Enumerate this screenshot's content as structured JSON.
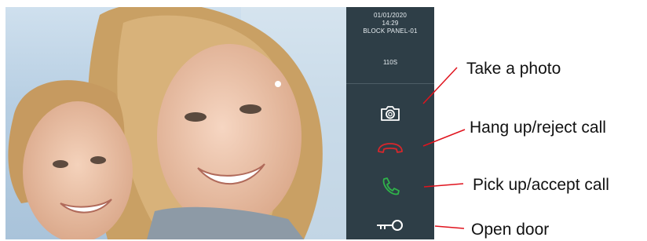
{
  "panel": {
    "date": "01/01/2020",
    "time": "14:29",
    "device": "BLOCK PANEL-01",
    "timer": "110S"
  },
  "controls": [
    {
      "icon": "camera-icon",
      "color": "#ffffff"
    },
    {
      "icon": "hang-up-icon",
      "color": "#d9262b"
    },
    {
      "icon": "phone-icon",
      "color": "#2fb34a"
    },
    {
      "icon": "key-icon",
      "color": "#ffffff"
    }
  ],
  "callouts": {
    "photo": "Take a photo",
    "hangup": "Hang up/reject call",
    "pickup": "Pick up/accept call",
    "door": "Open door"
  },
  "colors": {
    "panel_bg": "#2e3e47",
    "leader_line": "#e0141e"
  }
}
